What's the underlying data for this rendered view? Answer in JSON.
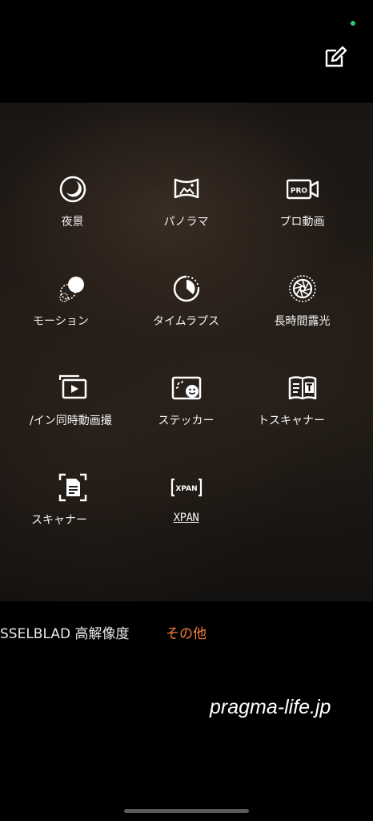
{
  "header": {
    "edit_icon": "edit-icon",
    "status_dot_color": "#2ecc71"
  },
  "modes": [
    {
      "label": "夜景",
      "icon": "night-icon"
    },
    {
      "label": "パノラマ",
      "icon": "panorama-icon"
    },
    {
      "label": "プロ動画",
      "icon": "pro-video-icon"
    },
    {
      "label": "モーション",
      "icon": "motion-icon"
    },
    {
      "label": "タイムラプス",
      "icon": "timelapse-icon"
    },
    {
      "label": "長時間露光",
      "icon": "long-exposure-icon"
    },
    {
      "label": "/イン同時動画撮",
      "icon": "dual-view-icon"
    },
    {
      "label": "ステッカー",
      "icon": "sticker-icon"
    },
    {
      "label": "トスキャナー",
      "icon": "text-scanner-icon"
    },
    {
      "label": "スキャナー",
      "icon": "document-scanner-icon"
    },
    {
      "label": "XPAN",
      "icon": "xpan-icon"
    }
  ],
  "bottom_tabs": {
    "hasselblad": "SSELBLAD 高解像度",
    "other": "その他",
    "active_color": "#f0803c"
  },
  "watermark": "pragma-life.jp"
}
